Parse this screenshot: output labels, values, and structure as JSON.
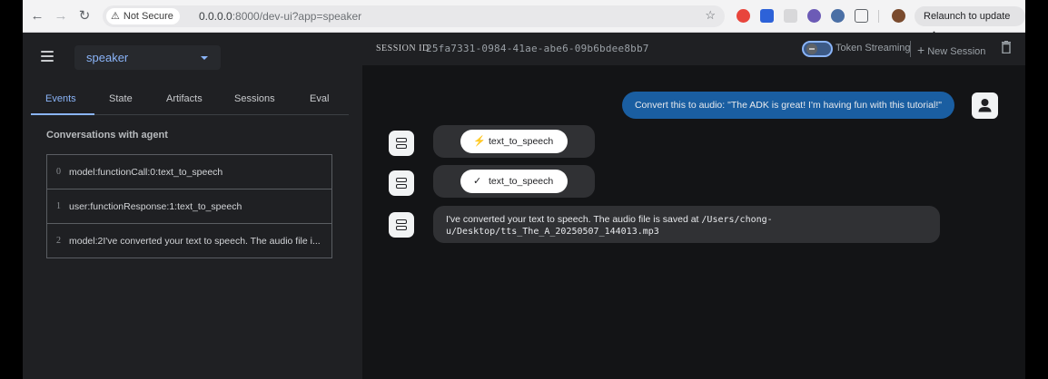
{
  "browser": {
    "secure_label": "Not Secure",
    "url_host": "0.0.0.0",
    "url_rest": ":8000/dev-ui?app=speaker",
    "relaunch_label": "Relaunch to update"
  },
  "sidebar": {
    "app_name": "speaker",
    "tabs": [
      {
        "label": "Events",
        "active": true
      },
      {
        "label": "State"
      },
      {
        "label": "Artifacts"
      },
      {
        "label": "Sessions"
      },
      {
        "label": "Eval"
      }
    ],
    "conversation_title": "Conversations with agent",
    "events": [
      {
        "index": "0",
        "text": "model:functionCall:0:text_to_speech"
      },
      {
        "index": "1",
        "text": "user:functionResponse:1:text_to_speech"
      },
      {
        "index": "2",
        "text": "model:2I've converted your text to speech. The audio file i..."
      }
    ]
  },
  "topbar": {
    "session_label": "SESSION ID",
    "session_id": "25fa7331-0984-41ae-abe6-09b6bdee8bb7",
    "streaming_label": "Token Streaming",
    "new_session_label": "New Session"
  },
  "chat": {
    "user_message": "Convert this to audio: \"The ADK is great! I'm having fun with this tutorial!\"",
    "function_call_label": "text_to_speech",
    "function_response_label": "text_to_speech",
    "bot_text_line1": "I've converted your text to speech. The audio file is saved at",
    "bot_text_path1": "/Users/chong-",
    "bot_text_line2": "u/Desktop/tts_The_A_20250507_144013.mp3"
  },
  "colors": {
    "accent": "#8ab4f8",
    "user_bubble": "#1a5ea1",
    "panel": "#1f2023",
    "chat_bg": "#131416"
  }
}
